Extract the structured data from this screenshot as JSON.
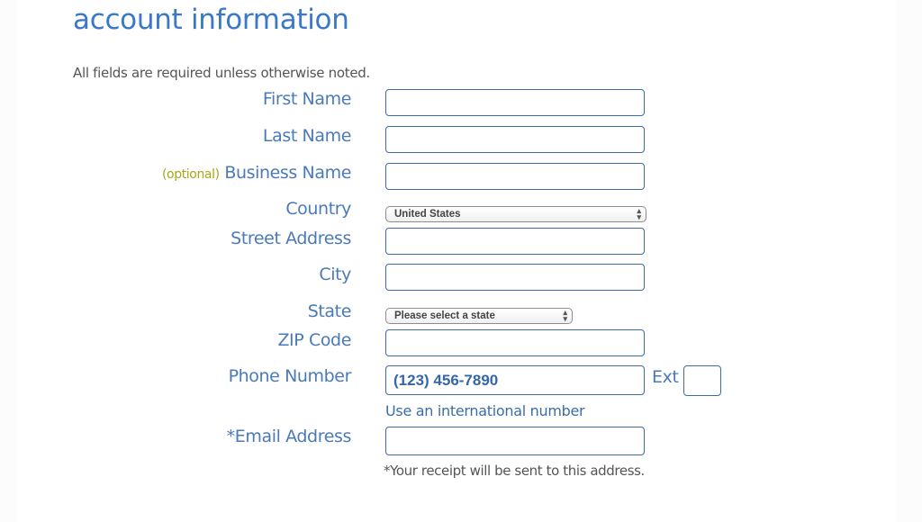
{
  "header": {
    "title": "account information",
    "required_note": "All fields are required unless otherwise noted."
  },
  "form": {
    "first_name": {
      "label": "First Name",
      "value": ""
    },
    "last_name": {
      "label": "Last Name",
      "value": ""
    },
    "business_name": {
      "optional_tag": "(optional)",
      "label": "Business Name",
      "value": ""
    },
    "country": {
      "label": "Country",
      "selected": "United States"
    },
    "street_address": {
      "label": "Street Address",
      "value": ""
    },
    "city": {
      "label": "City",
      "value": ""
    },
    "state": {
      "label": "State",
      "selected": "Please select a state"
    },
    "zip": {
      "label": "ZIP Code",
      "value": ""
    },
    "phone": {
      "label": "Phone Number",
      "placeholder": "(123) 456-7890",
      "ext_label": "Ext",
      "ext_value": "",
      "intl_link": "Use an international number"
    },
    "email": {
      "label": "*Email Address",
      "value": "",
      "note": "*Your receipt will be sent to this address."
    }
  },
  "colors": {
    "accent": "#3a78c9",
    "label": "#4a7ab8",
    "optional": "#a6a61a",
    "input_border": "#3f6ba3"
  }
}
